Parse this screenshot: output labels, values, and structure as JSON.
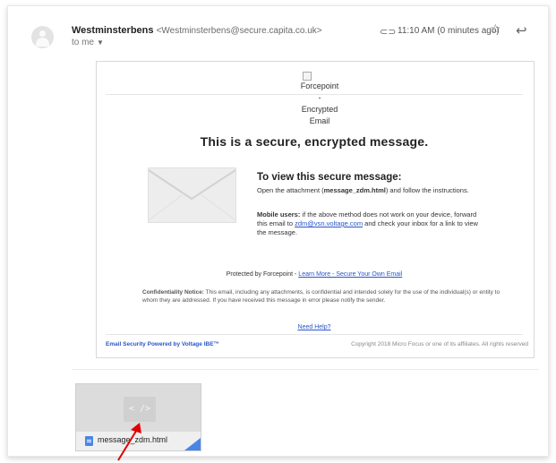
{
  "header": {
    "sender_name": "Westminsterbens",
    "sender_address": "<Westminsterbens@secure.capita.co.uk>",
    "recipient": "to me",
    "time": "11:10 AM (0 minutes ago)"
  },
  "message": {
    "logo_alt": [
      "Forcepoint",
      "-",
      "Encrypted",
      "Email"
    ],
    "headline": "This is a secure, encrypted message.",
    "view_title": "To view this secure message:",
    "view_instr_pre": "Open the attachment (",
    "attachment_ref": "message_zdm.html",
    "view_instr_post": ") and follow the instructions.",
    "mobile_label": "Mobile users:",
    "mobile_text_pre": " if the above method does not work on your device, forward this email to ",
    "mobile_email": "zdm@vsn.voltage.com",
    "mobile_text_post": " and check your inbox for a link to view the message.",
    "protected_text": "Protected by Forcepoint - ",
    "protected_link": "Learn More - Secure Your Own Email",
    "conf_label": "Confidentiality Notice:",
    "conf_text": " This email, including any attachments, is confidential and intended solely for the use of the individual(s) or entity to whom they are addressed. If you have received this message in error please notify the sender.",
    "need_help": "Need Help?",
    "footer_left": "Email Security Powered by Voltage IBE™",
    "footer_right": "Copyright 2018 Micro Focus or one of its affiliates. All rights reserved"
  },
  "attachment": {
    "preview_glyph": "< />",
    "filename": "message_zdm.html"
  },
  "icons": [
    "avatar",
    "attachment-icon",
    "star-icon",
    "reply-icon",
    "envelope-icon",
    "file-icon",
    "red-arrow"
  ],
  "colors": {
    "link": "#2a56c6",
    "file": "#4a86e8",
    "arrow": "#e00000"
  }
}
